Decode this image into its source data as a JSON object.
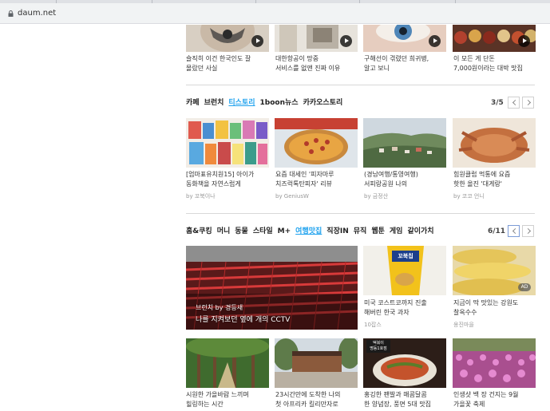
{
  "browser": {
    "url": "daum.net"
  },
  "row_top": {
    "items": [
      {
        "caption1": "슬직히 이건 한국인도 잘",
        "caption2": "몰랐던 사실"
      },
      {
        "caption1": "대한항공이 망중",
        "caption2": "서비스를 없앤 진짜 이유"
      },
      {
        "caption1": "구해선이 겪렸던 희귀병,",
        "caption2": "알고 보니"
      },
      {
        "caption1": "이 모든 게 단돈",
        "caption2": "7,000원이라는 대박 맛집"
      }
    ]
  },
  "section1": {
    "tabs": [
      "카페",
      "브런치",
      "티스토리",
      "1boon뉴스",
      "카카오스토리"
    ],
    "pager": "3/5",
    "items": [
      {
        "caption1": "[엄마표유치원15] 아이가",
        "caption2": "동화책을 자연스럽게",
        "source": "by 꼬북이나"
      },
      {
        "caption1": "요즘 대세인 '피자마루",
        "caption2": "치즈럭톡탄피자' 리뷰",
        "source": "by GeniusW"
      },
      {
        "caption1": "(경남여행/통영여행)",
        "caption2": "서피랑공원 나의",
        "source": "by 금정산"
      },
      {
        "caption1": "힘원클럽 먹통에 요즘",
        "caption2": "핫한 올진 '대게랑'",
        "source": "by 코코 언니"
      }
    ]
  },
  "section2": {
    "tabs": [
      "홈&쿠킹",
      "머니",
      "동물",
      "스타일",
      "M+",
      "여행맛집",
      "직장IN",
      "뮤직",
      "웹툰",
      "게임",
      "같이가치"
    ],
    "pager": "6/11",
    "feature": {
      "label": "브런치 by 경등새",
      "title": "나를 지켜보던 옆에 개의 CCTV"
    },
    "side_items": [
      {
        "caption1": "미국 코스트코까지 진출",
        "caption2": "해버린 한국 과자",
        "source": "10잡스",
        "pack_text": "꼬북칩"
      },
      {
        "caption1": "지금이 딱 맛있는 강원도",
        "caption2": "찰옥수수",
        "source": "옹진마을",
        "badge": "AD"
      }
    ],
    "bottom_items": [
      {
        "caption1": "시원한 가을바람 느끼며",
        "caption2": "힐링하는 시간"
      },
      {
        "caption1": "23시간만에 도착한 나의",
        "caption2": "첫 아프리카 킬리만자로"
      },
      {
        "caption1": "홍깅한 팬발과 매콤달콤",
        "caption2": "한 양념장, 풍면 5대 맛집",
        "sign1": "떡볶이",
        "sign2": "명동1호점"
      },
      {
        "caption1": "인생샷 백 장 건지는 9월",
        "caption2": "가을꽃 축제"
      }
    ]
  }
}
